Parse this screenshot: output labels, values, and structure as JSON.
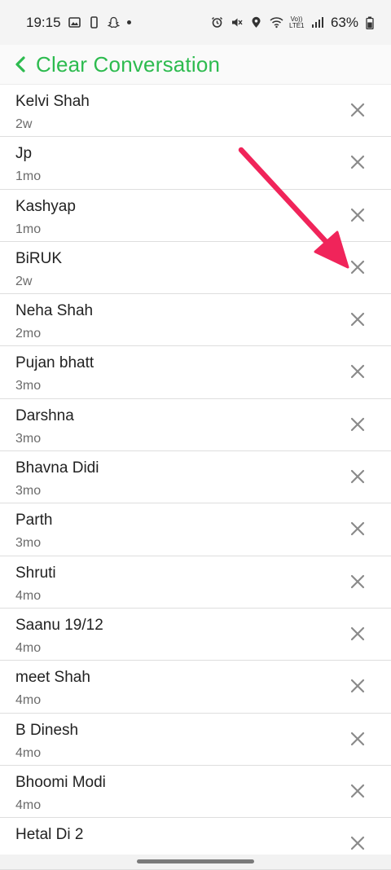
{
  "status_bar": {
    "time": "19:15",
    "battery": "63%",
    "network_label": "Vo)) LTE1"
  },
  "header": {
    "title": "Clear Conversation",
    "accent_color": "#2dbb4f"
  },
  "conversations": [
    {
      "name": "Kelvi Shah",
      "time": "2w"
    },
    {
      "name": "Jp",
      "time": "1mo"
    },
    {
      "name": "Kashyap",
      "time": "1mo"
    },
    {
      "name": "BiRUK",
      "time": "2w"
    },
    {
      "name": "Neha Shah",
      "time": "2mo"
    },
    {
      "name": "Pujan bhatt",
      "time": "3mo"
    },
    {
      "name": "Darshna",
      "time": "3mo"
    },
    {
      "name": "Bhavna Didi",
      "time": "3mo"
    },
    {
      "name": "Parth",
      "time": "3mo"
    },
    {
      "name": "Shruti",
      "time": "4mo"
    },
    {
      "name": "Saanu 19/12",
      "time": "4mo"
    },
    {
      "name": "meet Shah",
      "time": "4mo"
    },
    {
      "name": "B Dinesh",
      "time": "4mo"
    },
    {
      "name": "Bhoomi Modi",
      "time": "4mo"
    },
    {
      "name": "Hetal Di 2",
      "time": ""
    }
  ],
  "icons": {
    "back": "chevron-left-icon",
    "remove": "close-icon",
    "annotation": "pointer-arrow"
  },
  "annotation_color": "#f0245a"
}
